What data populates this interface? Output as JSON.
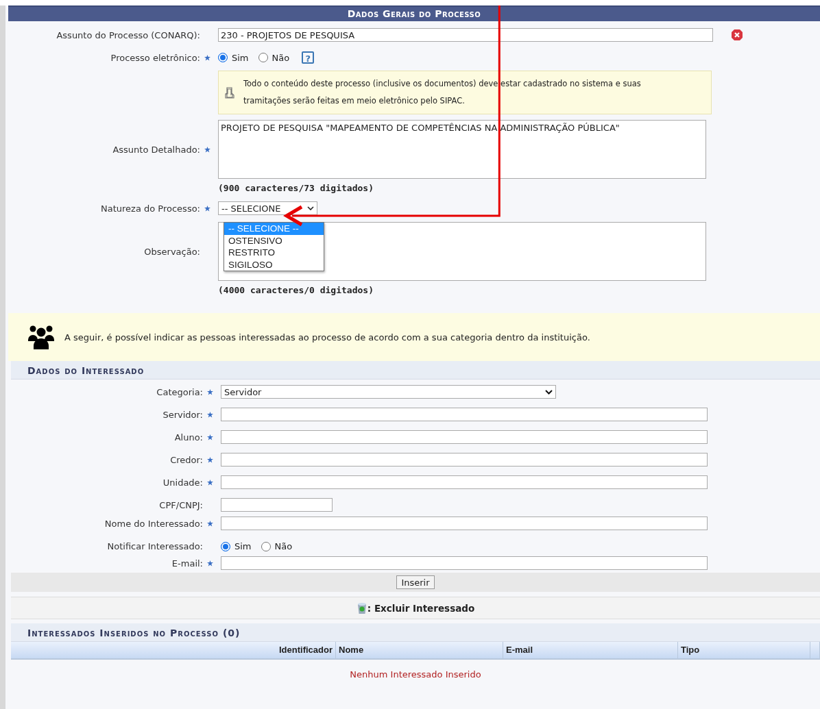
{
  "dados_gerais": {
    "title": "Dados Gerais do Processo",
    "assunto": {
      "label": "Assunto do Processo (CONARQ):",
      "required": false,
      "value": "230 - PROJETOS DE PESQUISA"
    },
    "processo_eletronico": {
      "label": "Processo eletrônico:",
      "required": true,
      "help": "?",
      "options": [
        {
          "label": "Sim",
          "selected": true
        },
        {
          "label": "Não",
          "selected": false
        }
      ]
    },
    "notice": "Todo o conteúdo deste processo (inclusive os documentos) deve estar cadastrado no sistema e suas tramitações serão feitas em meio eletrônico pelo SIPAC.",
    "assunto_detalhado": {
      "label": "Assunto Detalhado:",
      "required": true,
      "value": "PROJETO DE PESQUISA \"MAPEAMENTO DE COMPETÊNCIAS NA ADMINISTRAÇÃO PÚBLICA\"",
      "counter": "(900 caracteres/73 digitados)"
    },
    "natureza": {
      "label": "Natureza do Processo:",
      "required": true,
      "value": "-- SELECIONE",
      "expanded": true,
      "options": [
        {
          "label": "-- SELECIONE --",
          "selected": true
        },
        {
          "label": "OSTENSIVO",
          "selected": false
        },
        {
          "label": "RESTRITO",
          "selected": false
        },
        {
          "label": "SIGILOSO",
          "selected": false
        }
      ]
    },
    "observacao": {
      "label": "Observação:",
      "required": false,
      "counter": "(4000 caracteres/0 digitados)"
    }
  },
  "info_notice": "A seguir, é possível indicar as pessoas interessadas ao processo de acordo com a sua categoria dentro da instituição.",
  "dados_interessado": {
    "title": "Dados do Interessado",
    "fields": [
      {
        "kind": "select",
        "label": "Categoria:",
        "required": true,
        "value": "Servidor"
      },
      {
        "kind": "text",
        "label": "Servidor:",
        "required": true
      },
      {
        "kind": "text",
        "label": "Aluno:",
        "required": true
      },
      {
        "kind": "text",
        "label": "Credor:",
        "required": true
      },
      {
        "kind": "text",
        "label": "Unidade:",
        "required": true
      },
      {
        "kind": "short",
        "label": "CPF/CNPJ:",
        "required": false
      },
      {
        "kind": "text",
        "label": "Nome do Interessado:",
        "required": true
      },
      {
        "kind": "radio",
        "label": "Notificar Interessado:",
        "required": false,
        "options": [
          {
            "label": "Sim",
            "selected": true
          },
          {
            "label": "Não",
            "selected": false
          }
        ]
      },
      {
        "kind": "text",
        "label": "E-mail:",
        "required": true
      }
    ],
    "button": "Inserir"
  },
  "legend": ": Excluir Interessado",
  "interessados": {
    "title": "Interessados Inseridos no Processo (0)",
    "columns": [
      "Identificador",
      "Nome",
      "E-mail",
      "Tipo"
    ],
    "empty": "Nenhum Interessado Inserido"
  }
}
